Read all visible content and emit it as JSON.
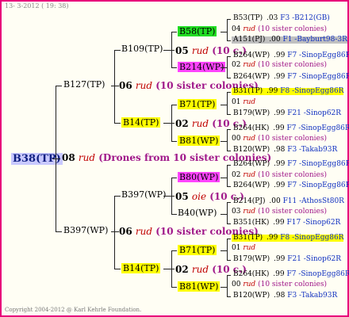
{
  "header": "13-  3-2012 ( 19: 38)",
  "footer": "Copyright 2004-2012 @ Karl Kehrle Foundation.",
  "colors": {
    "green": "#22dd22",
    "yellow": "#ffff00",
    "magenta": "#ff44ff",
    "gray": "#c0c0c0",
    "frame": "#e8007a"
  },
  "root": {
    "name": "B38(TP)",
    "gen": "08",
    "rud": "rud",
    "note": "(Drones from 10 sister colonies)"
  },
  "g1": [
    {
      "name": "B127(TP)",
      "gen": "06",
      "rud": "rud",
      "note": "(10 sister colonies)"
    },
    {
      "name": "B397(WP)",
      "gen": "06",
      "rud": "rud",
      "note": "(10 sister colonies)"
    }
  ],
  "g2": [
    {
      "name": "B109(TP)",
      "gen": "05",
      "rud": "rud",
      "note": "(10 c.)"
    },
    {
      "name": "B14(TP)",
      "gen": "02",
      "rud": "rud",
      "note": "(10 c.)"
    },
    {
      "name": "B397(WP)",
      "gen": "05",
      "rud": "oie",
      "note": "(10 c.)"
    },
    {
      "name": "B14(TP)",
      "gen": "02",
      "rud": "rud",
      "note": "(10 c.)"
    }
  ],
  "g3": [
    {
      "name": "B58(TP)",
      "gen": "04",
      "rud": "rud",
      "note": "(10 sister colonies)"
    },
    {
      "name": "B214(WP)",
      "gen": "02",
      "rud": "rud",
      "note": "(10 sister colonies)"
    },
    {
      "name": "B71(TP)",
      "gen": "01",
      "rud": "rud",
      "note": ""
    },
    {
      "name": "B81(WP)",
      "gen": "00",
      "rud": "rud",
      "note": "(10 sister colonies)"
    },
    {
      "name": "B80(WP)",
      "gen": "02",
      "rud": "rud",
      "note": "(10 sister colonies)"
    },
    {
      "name": "B40(WP)",
      "gen": "03",
      "rud": "rud",
      "note": "(10 sister colonies)"
    },
    {
      "name": "B71(TP)",
      "gen": "01",
      "rud": "rud",
      "note": ""
    },
    {
      "name": "B81(WP)",
      "gen": "00",
      "rud": "rud",
      "note": "(10 sister colonies)"
    }
  ],
  "g4": [
    {
      "name": "B53(TP)",
      "val": ".03",
      "loc": "F3 -B212(GB)"
    },
    {
      "name": "A151(PJ)",
      "val": ".00",
      "loc": "F1 -Bayburt98-3R"
    },
    {
      "name": "B264(WP)",
      "val": ".99",
      "loc": "F7 -SinopEgg86R"
    },
    {
      "name": "B264(WP)",
      "val": ".99",
      "loc": "F7 -SinopEgg86R"
    },
    {
      "name": "B31(TP)",
      "val": ".99",
      "loc": "F8 -SinopEgg86R"
    },
    {
      "name": "B179(WP)",
      "val": ".99",
      "loc": "F21 -Sinop62R"
    },
    {
      "name": "B264(HK)",
      "val": ".99",
      "loc": "F7 -SinopEgg86R"
    },
    {
      "name": "B120(WP)",
      "val": ".98",
      "loc": "F3 -Takab93R"
    },
    {
      "name": "B264(WP)",
      "val": ".99",
      "loc": "F7 -SinopEgg86R"
    },
    {
      "name": "B264(WP)",
      "val": ".99",
      "loc": "F7 -SinopEgg86R"
    },
    {
      "name": "B214(PJ)",
      "val": ".00",
      "loc": "F11 -AthosSt80R"
    },
    {
      "name": "B351(HK)",
      "val": ".99",
      "loc": "F17 -Sinop62R"
    },
    {
      "name": "B31(TP)",
      "val": ".99",
      "loc": "F8 -SinopEgg86R"
    },
    {
      "name": "B179(WP)",
      "val": ".99",
      "loc": "F21 -Sinop62R"
    },
    {
      "name": "B264(HK)",
      "val": ".99",
      "loc": "F7 -SinopEgg86R"
    },
    {
      "name": "B120(WP)",
      "val": ".98",
      "loc": "F3 -Takab93R"
    }
  ]
}
